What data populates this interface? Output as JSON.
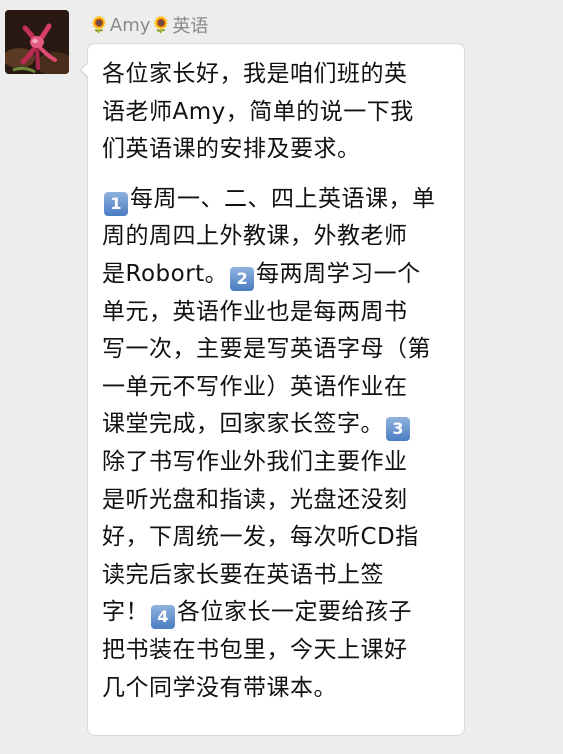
{
  "sender": {
    "name": "Amy",
    "badge": "英语",
    "emoji": "🌻"
  },
  "avatar": {
    "icon": "flower-photo-icon"
  },
  "message": {
    "intro": [
      "各位家长好，我是咱们班的英",
      "语老师Amy，简单的说一下我",
      "们英语课的安排及要求。"
    ],
    "keycaps": [
      "1",
      "2",
      "3",
      "4"
    ],
    "l1": "每周一、二、四上英语课，单",
    "l2": "周的周四上外教课，外教老师",
    "l3a": "是Robort。",
    "l3b": "每两周学习一个",
    "l4": "单元，英语作业也是每两周书",
    "l5": "写一次，主要是写英语字母（第",
    "l6": "一单元不写作业）英语作业在",
    "l7": "课堂完成，回家家长签字。",
    "l8": "除了书写作业外我们主要作业",
    "l9": "是听光盘和指读，光盘还没刻",
    "l10": "好，下周统一发，每次听CD指",
    "l11": "读完后家长要在英语书上签",
    "l12a": "字！",
    "l12b": "各位家长一定要给孩子",
    "l13": "把书装在书包里，今天上课好",
    "l14": "几个同学没有带课本。"
  }
}
